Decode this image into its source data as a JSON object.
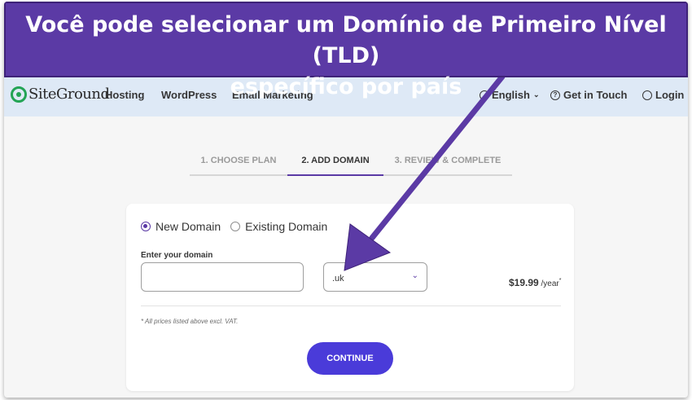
{
  "banner": {
    "line1": "Você pode selecionar um Domínio de Primeiro Nível (TLD)",
    "line2": "específico por país"
  },
  "nav": {
    "logo": "SiteGround",
    "items": [
      "Hosting",
      "WordPress",
      "Email Marketing"
    ],
    "language": "English",
    "contact": "Get in Touch",
    "login": "Login"
  },
  "steps": [
    {
      "label": "1. CHOOSE PLAN",
      "active": false
    },
    {
      "label": "2. ADD DOMAIN",
      "active": true
    },
    {
      "label": "3. REVIEW & COMPLETE",
      "active": false
    }
  ],
  "form": {
    "option_new": "New Domain",
    "option_existing": "Existing Domain",
    "domain_label": "Enter your domain",
    "domain_value": "",
    "tld_value": ".uk",
    "price": "$19.99",
    "price_period": " /year",
    "price_mark": "*",
    "vat_note": "* All prices listed above excl. VAT.",
    "continue_label": "CONTINUE"
  },
  "colors": {
    "accent": "#5b3aa5",
    "button": "#4a3bd9",
    "navbar": "#dee9f6"
  }
}
